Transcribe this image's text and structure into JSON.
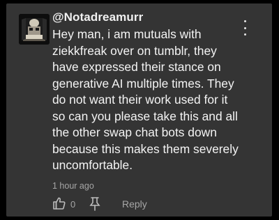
{
  "comment": {
    "author": "@Notadreamurr",
    "avatar": "avatar-image",
    "lines": [
      "Hey man, i am mutuals with",
      "ziekkfreak over on tumblr, they",
      "have expressed their stance on",
      "generative AI multiple times. They",
      "do not want their work used for it",
      "so can you please take this and all",
      "the other swap chat bots down",
      "because this makes them severely",
      "uncomfortable."
    ],
    "timestamp": "1 hour ago",
    "like_count": "0",
    "reply_label": "Reply"
  },
  "icons": {
    "menu": "more-vert-icon",
    "like": "thumbs-up-icon",
    "dislike": "pin-icon"
  },
  "colors": {
    "page_background": "#000000",
    "card_background": "#343434",
    "text_primary": "#f4f4f4",
    "text_secondary": "#a6a6a6"
  }
}
